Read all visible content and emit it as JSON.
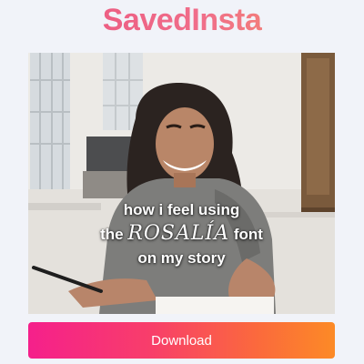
{
  "header": {
    "logo_text": "SavedInsta"
  },
  "media": {
    "caption_line1": "how i feel using",
    "caption_line2_pre": "the",
    "caption_line2_brand": "ROSALÍA",
    "caption_line2_post": "font",
    "caption_line3": "on my story"
  },
  "actions": {
    "download_label": "Download"
  },
  "colors": {
    "logo_pink": "#ee5f86",
    "button_start": "#f5208b",
    "button_end": "#fc8a26"
  }
}
